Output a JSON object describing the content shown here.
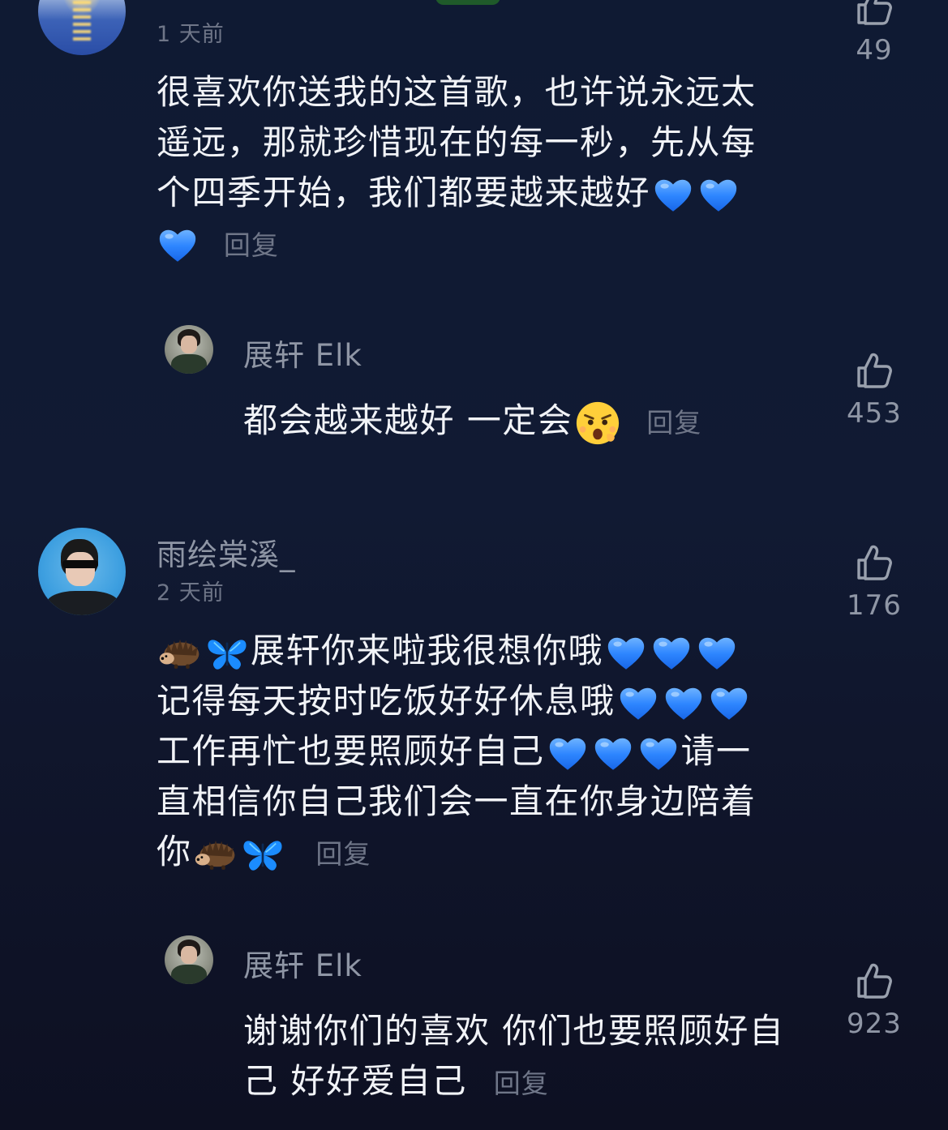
{
  "comments": [
    {
      "time": "1 天前",
      "text_lines": [
        "很喜欢你送我的这首歌，也许说永远太",
        "遥远，那就珍惜现在的每一秒，先从每",
        "个四季开始，我们都要越来越好"
      ],
      "reply_label": "回复",
      "likes": "49"
    },
    {
      "username": "展轩 Elk",
      "text": "都会越来越好 一定会",
      "reply_label": "回复",
      "likes": "453"
    },
    {
      "username": "雨绘棠溪_",
      "time": "2 天前",
      "text_lines": [
        "展轩你来啦我很想你哦",
        "记得每天按时吃饭好好休息哦",
        "工作再忙也要照顾好自己",
        "请一",
        "直相信你自己我们会一直在你身边陪着",
        "你"
      ],
      "reply_label": "回复",
      "likes": "176"
    },
    {
      "username": "展轩 Elk",
      "text_lines": [
        "谢谢你们的喜欢 你们也要照顾好自",
        "己 好好爱自己"
      ],
      "reply_label": "回复",
      "likes": "923"
    }
  ],
  "icons": {
    "like": "thumbs-up-icon",
    "heart": "blue-heart-icon",
    "hedgehog": "hedgehog-icon",
    "butterfly": "butterfly-icon",
    "surprised": "surprised-face-icon"
  },
  "colors": {
    "background": "#111a33",
    "text": "#f1f3f7",
    "muted": "#8f96a5",
    "heart": "#1f7bff"
  }
}
